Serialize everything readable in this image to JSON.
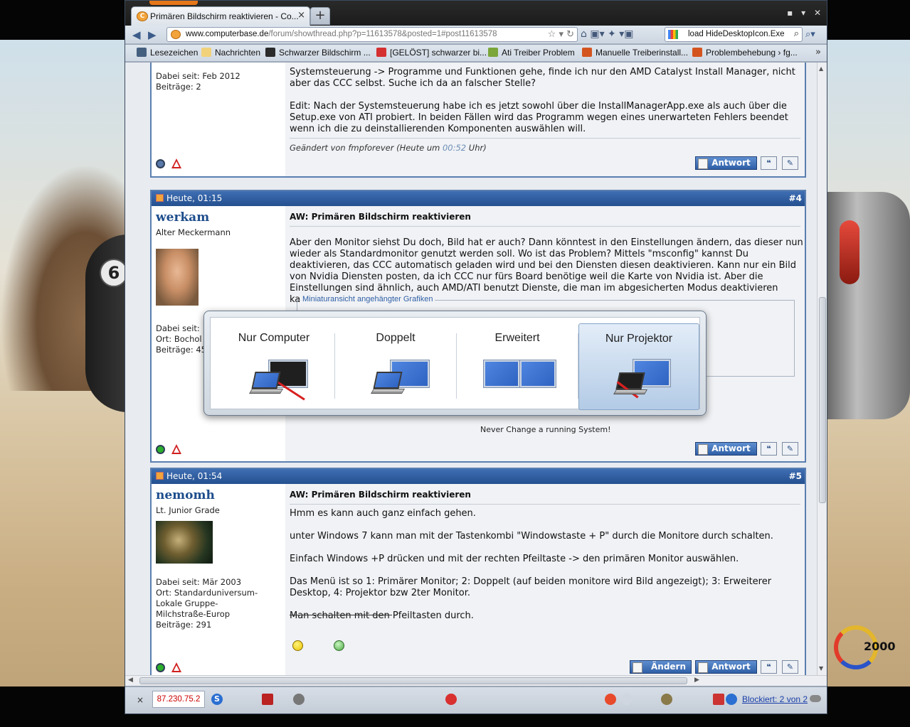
{
  "browser": {
    "tab_title": "Primären Bildschirm reaktivieren - Co...",
    "tab_close": "×",
    "new_tab": "+",
    "window_controls": "▪ ▾ ✕",
    "url_domain": "www.computerbase.de",
    "url_path": "/forum/showthread.php?p=11613578&posted=1#post11613578",
    "search_text": "load HideDesktopIcon.Exe",
    "bookmarks": [
      "Lesezeichen",
      "Nachrichten",
      "Schwarzer Bildschirm ...",
      "[GELÖST] schwarzer bi...",
      "Ati Treiber Problem",
      "Manuelle Treiberinstall...",
      "Problembehebung › fg..."
    ],
    "bookmarks_more": "»"
  },
  "post3": {
    "joined": "Dabei seit: Feb 2012",
    "posts": "Beiträge: 2",
    "text_top": "Systemsteuerung -> Programme und Funktionen gehe, finde ich nur den AMD Catalyst Install Manager, nicht aber das CCC selbst. Suche ich da an falscher Stelle?",
    "text_edit": "Edit: Nach der Systemsteuerung habe ich es jetzt sowohl über die InstallManagerApp.exe als auch über die Setup.exe von ATI probiert. In beiden Fällen wird das Programm wegen eines unerwarteten Fehlers beendet wenn ich die zu deinstallierenden Komponenten auswählen will.",
    "edited_prefix": "Geändert von fmpforever (Heute um ",
    "edited_time": "00:52",
    "edited_suffix": " Uhr)",
    "reply": "Antwort"
  },
  "post4": {
    "date": "Heute, 01:15",
    "number": "#4",
    "username": "werkam",
    "rank": "Alter Meckermann",
    "joined": "Dabei seit:",
    "location": "Ort: Bochol",
    "posts": "Beiträge: 45",
    "title": "AW: Primären Bildschirm reaktivieren",
    "text": "Aber den Monitor siehst Du doch, Bild hat er auch? Dann könntest in den Einstellungen ändern, das dieser nun wieder als Standardmonitor genutzt werden soll. Wo ist das Problem? Mittels \"msconfig\" kannst Du deaktivieren, das CCC automatisch geladen wird und bei den Diensten diesen deaktivieren. Kann nur ein Bild von Nvidia Diensten posten, da ich CCC nur fürs Board benötige weil die Karte von Nvidia ist. Aber die Einstellungen sind ähnlich, auch AMD/ATI benutzt Dienste, die man im abgesicherten Modus deaktivieren kann.",
    "attach_legend": "Miniaturansicht angehängter Grafiken",
    "signature": "Never Change a running System!",
    "reply": "Antwort"
  },
  "post5": {
    "date": "Heute, 01:54",
    "number": "#5",
    "username": "nemomh",
    "rank": "Lt. Junior Grade",
    "joined": "Dabei seit: Mär 2003",
    "location_1": "Ort: Standarduniversum-",
    "location_2": "Lokale Gruppe-",
    "location_3": "Milchstraße-Europ",
    "posts": "Beiträge: 291",
    "title": "AW: Primären Bildschirm reaktivieren",
    "p1": "Hmm es kann auch ganz einfach gehen.",
    "p2": "unter Windows 7 kann man mit der Tastenkombi \"Windowstaste + P\" durch die Monitore durch schalten.",
    "p3": "Einfach Windows +P drücken und mit der rechten Pfeiltaste -> den primären Monitor auswählen.",
    "p4": "Das Menü ist so 1: Primärer Monitor; 2: Doppelt (auf beiden monitore wird Bild angezeigt); 3: Erweiterer Desktop, 4: Projektor bzw 2ter Monitor.",
    "p5": "Man schalten mit den Pfeiltasten durch.",
    "edit": "Ändern",
    "reply": "Antwort"
  },
  "display_switch": {
    "options": [
      "Nur Computer",
      "Doppelt",
      "Erweitert",
      "Nur Projektor"
    ],
    "selected": "Nur Projektor"
  },
  "statusbar": {
    "close": "×",
    "ip": "87.230.75.2",
    "blocked": "Blockiert: 2 von 2"
  },
  "wallpaper": {
    "badge": "6",
    "logo": "2000"
  }
}
